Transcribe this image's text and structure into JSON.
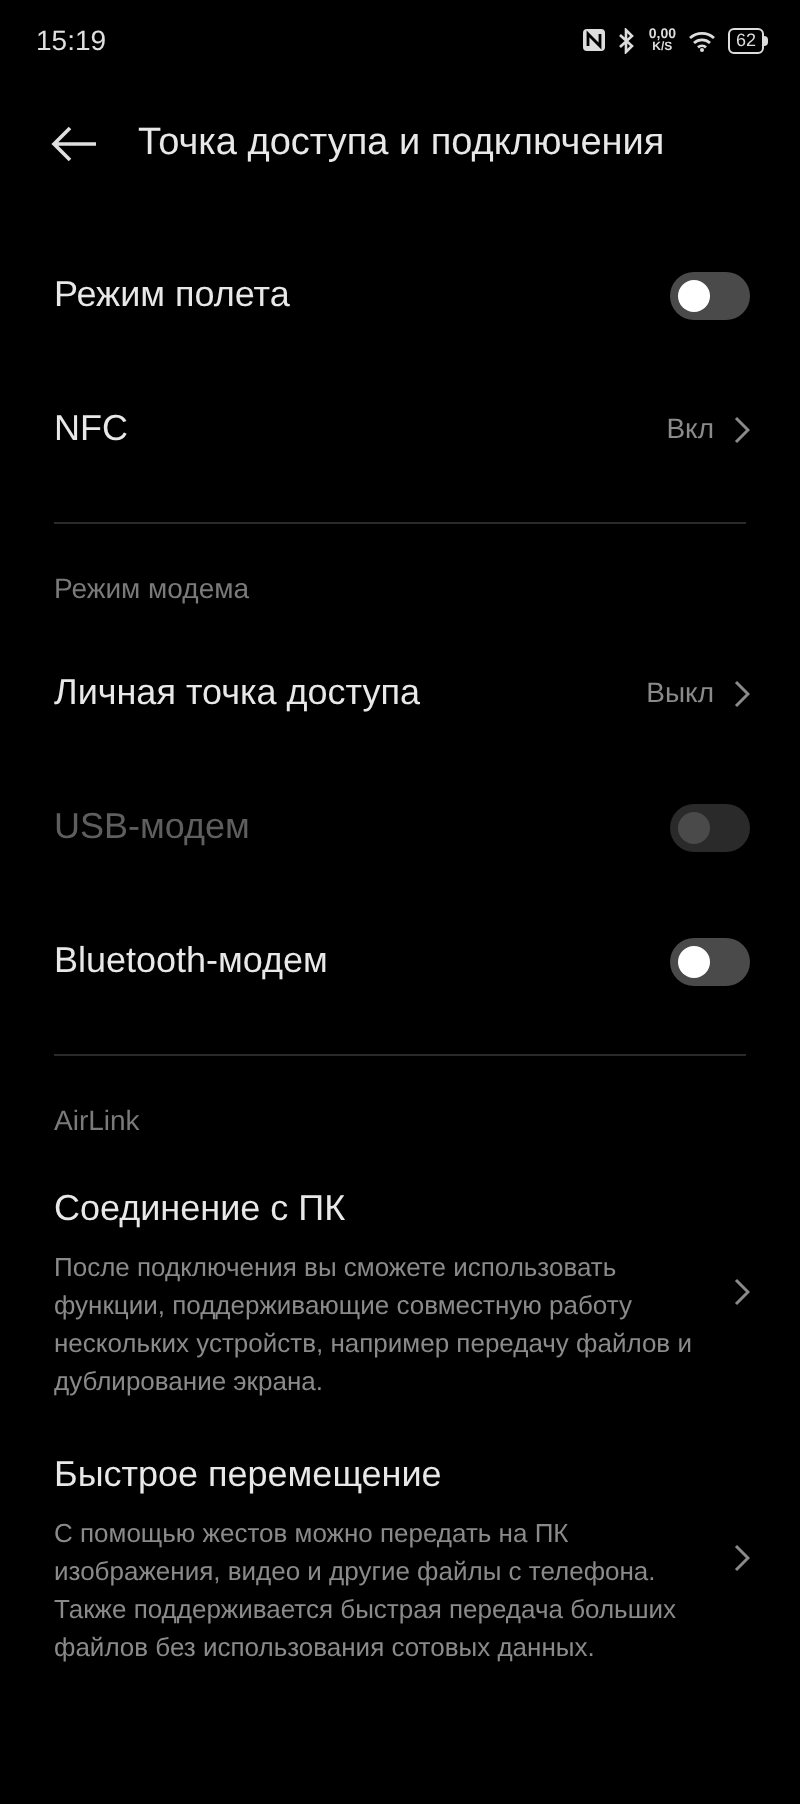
{
  "status_bar": {
    "time": "15:19",
    "speed_value": "0,00",
    "speed_unit": "K/S",
    "battery": "62"
  },
  "header": {
    "title": "Точка доступа и подключения"
  },
  "items": [
    {
      "kind": "toggle",
      "label": "Режим полета",
      "on": false,
      "disabled": false
    },
    {
      "kind": "link",
      "label": "NFC",
      "value": "Вкл"
    },
    {
      "kind": "divider"
    },
    {
      "kind": "section",
      "label": "Режим модема"
    },
    {
      "kind": "link",
      "label": "Личная точка доступа",
      "value": "Выкл"
    },
    {
      "kind": "toggle",
      "label": "USB-модем",
      "on": false,
      "disabled": true
    },
    {
      "kind": "toggle",
      "label": "Bluetooth-модем",
      "on": false,
      "disabled": false
    },
    {
      "kind": "divider"
    },
    {
      "kind": "section",
      "label": "AirLink"
    },
    {
      "kind": "detail",
      "label": "Соединение с ПК",
      "description": "После подключения вы сможете использовать функции, поддерживающие совместную работу нескольких устройств, например передачу файлов и дублирование экрана."
    },
    {
      "kind": "detail",
      "label": "Быстрое перемещение",
      "description": "С помощью жестов можно передать на ПК изображения, видео и другие файлы с телефона. Также поддерживается быстрая передача больших файлов без использования сотовых данных."
    }
  ]
}
